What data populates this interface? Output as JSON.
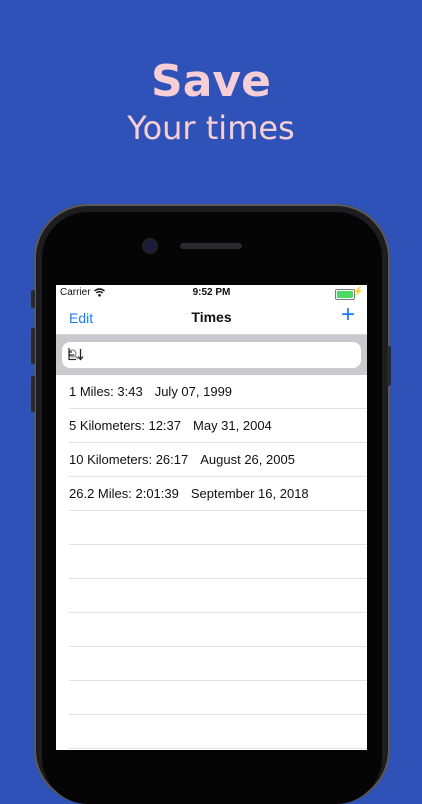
{
  "headline": {
    "title": "Save",
    "subtitle": "Your times"
  },
  "status_bar": {
    "carrier": "Carrier",
    "time": "9:52 PM"
  },
  "navbar": {
    "edit_label": "Edit",
    "title": "Times",
    "add_label": "+"
  },
  "search": {
    "placeholder": "",
    "value": ""
  },
  "entries": [
    {
      "result": "1 Miles: 3:43",
      "date": "July 07, 1999"
    },
    {
      "result": "5 Kilometers: 12:37",
      "date": "May 31, 2004"
    },
    {
      "result": "10 Kilometers: 26:17",
      "date": "August 26, 2005"
    },
    {
      "result": "26.2 Miles: 2:01:39",
      "date": "September 16, 2018"
    }
  ],
  "colors": {
    "background": "#2f52b8",
    "headline": "#f6cfd6",
    "accent": "#1a7cf5",
    "battery": "#4cd964"
  }
}
